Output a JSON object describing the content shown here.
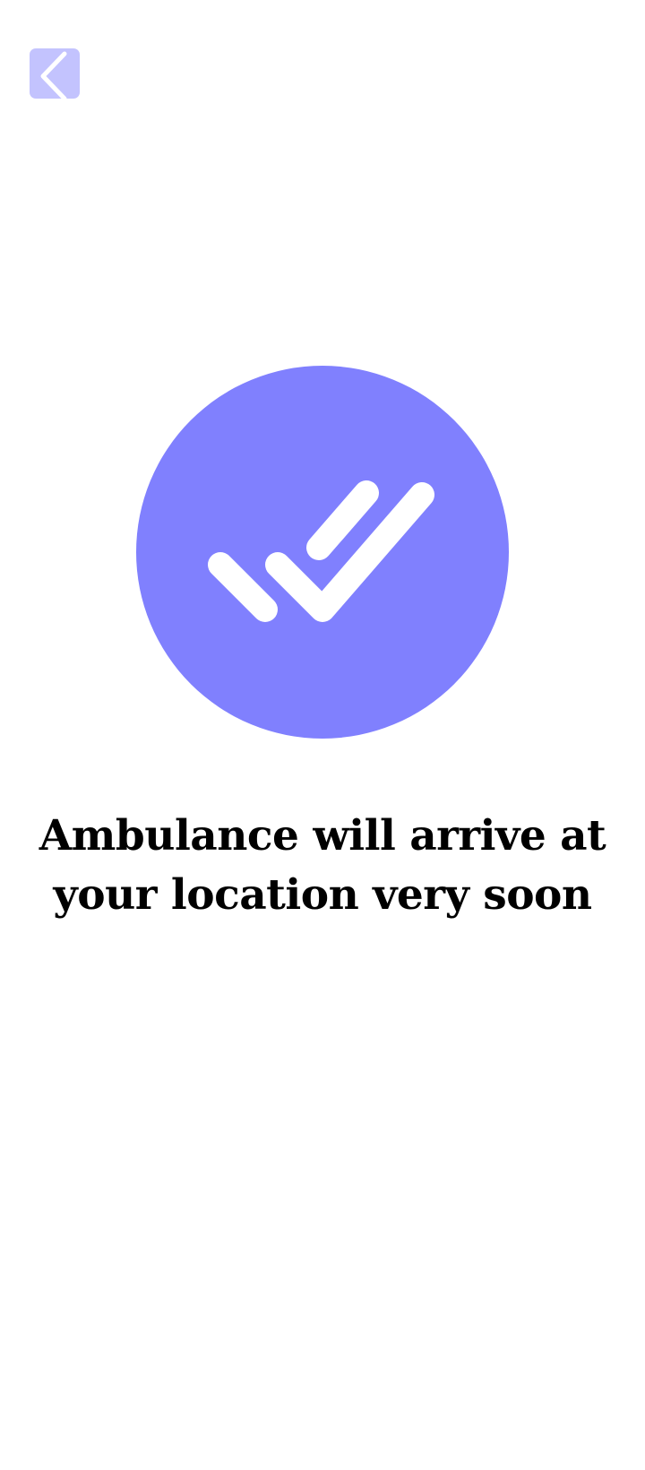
{
  "header": {
    "back_icon": "chevron-left-icon"
  },
  "confirmation": {
    "icon": "double-check-icon",
    "message": "Ambulance will arrive at your location very soon"
  },
  "colors": {
    "accent": "#8080fe",
    "back_button_bg": "#c3c3fe",
    "icon_color": "#ffffff",
    "text": "#000000",
    "background": "#ffffff"
  }
}
